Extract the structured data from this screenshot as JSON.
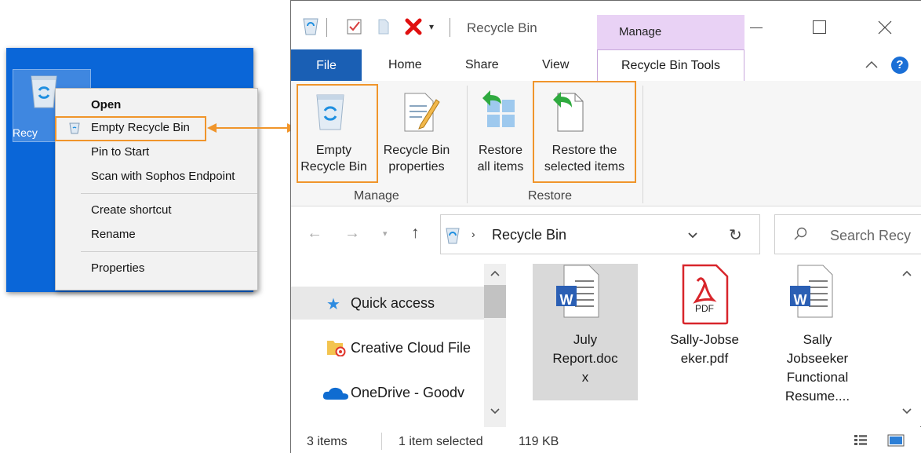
{
  "desktop": {
    "icon_label": "Recy",
    "context_menu": {
      "items": [
        {
          "label": "Open",
          "bold": true
        },
        {
          "label": "Empty Recycle Bin",
          "highlighted": true
        },
        {
          "label": "Pin to Start"
        },
        {
          "label": "Scan with Sophos Endpoint"
        },
        {
          "label": "Create shortcut"
        },
        {
          "label": "Rename"
        },
        {
          "label": "Properties"
        }
      ]
    }
  },
  "window": {
    "title": "Recycle Bin",
    "context_tab_group": "Manage",
    "tabs": [
      "File",
      "Home",
      "Share",
      "View",
      "Recycle Bin Tools"
    ],
    "ribbon": {
      "groups": [
        {
          "name": "Manage",
          "buttons": [
            {
              "line1": "Empty",
              "line2": "Recycle Bin",
              "icon": "recycle-bin-icon",
              "highlighted": true
            },
            {
              "line1": "Recycle Bin",
              "line2": "properties",
              "icon": "properties-icon"
            }
          ]
        },
        {
          "name": "Restore",
          "buttons": [
            {
              "line1": "Restore",
              "line2": "all items",
              "icon": "restore-all-icon"
            },
            {
              "line1": "Restore the",
              "line2": "selected items",
              "icon": "restore-selected-icon",
              "highlighted": true
            }
          ]
        }
      ]
    },
    "address": {
      "location": "Recycle Bin",
      "search_placeholder": "Search Recy"
    },
    "nav_pane": [
      "Quick access",
      "Creative Cloud File",
      "OneDrive - Goodv"
    ],
    "files": [
      {
        "lines": [
          "July",
          "Report.doc",
          "x"
        ],
        "type": "word",
        "selected": true
      },
      {
        "lines": [
          "Sally-Jobse",
          "eker.pdf"
        ],
        "type": "pdf",
        "icon_text": "PDF"
      },
      {
        "lines": [
          "Sally",
          "Jobseeker",
          "Functional",
          "Resume...."
        ],
        "type": "word"
      }
    ],
    "status": {
      "count": "3 items",
      "selected": "1 item selected",
      "size": "119 KB"
    },
    "word_icon_letter": "W"
  },
  "colors": {
    "highlight": "#f0952b",
    "desktop": "#0a66d8",
    "file_tab": "#1a5fb4",
    "manage_tab": "#e9d2f5"
  }
}
